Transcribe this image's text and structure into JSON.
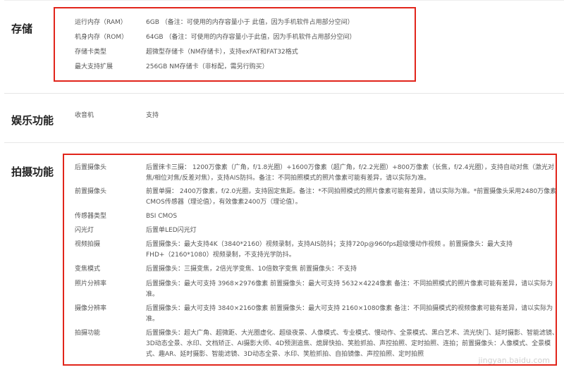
{
  "storage": {
    "title": "存储",
    "rows": [
      {
        "k": "运行内存（RAM）",
        "v": "6GB （备注：可使用的内存容量小于 此值，因为手机软件占用部分空间）"
      },
      {
        "k": "机身内存（ROM）",
        "v": "64GB （备注：可使用的内存容量小于此值，因为手机软件占用部分空间）"
      },
      {
        "k": "存储卡类型",
        "v": "超微型存储卡（NM存储卡），支持exFAT和FAT32格式"
      },
      {
        "k": "最大支持扩展",
        "v": "256GB NM存储卡（非标配，需另行购买）"
      }
    ]
  },
  "entertainment": {
    "title": "娱乐功能",
    "rows": [
      {
        "k": "收音机",
        "v": "支持"
      }
    ]
  },
  "camera": {
    "title": "拍摄功能",
    "rows": [
      {
        "k": "后置摄像头",
        "v": "后置徕卡三摄： 1200万像素（广角，f/1.8光圈）+1600万像素（超广角，f/2.2光圈）+800万像素（长焦，f/2.4光圈），支持自动对焦（激光对焦/相位对焦/反差对焦），支持AIS防抖。备注：不同拍照模式的照片像素可能有差异，请以实际为准。"
      },
      {
        "k": "前置摄像头",
        "v": "前置单摄： 2400万像素，f/2.0光圈，支持固定焦距。备注：*不同拍照模式的照片像素可能有差异，请以实际为准。*前置摄像头采用2480万像素CMOS传感器（理论值），有效像素2400万（理论值）。"
      },
      {
        "k": "传感器类型",
        "v": "BSI CMOS"
      },
      {
        "k": "闪光灯",
        "v": "后置单LED闪光灯"
      },
      {
        "k": "视频拍摄",
        "v": "后置摄像头：最大支持4K（3840*2160）视频录制，支持AIS防抖；支持720p@960fps超级慢动作视频 。前置摄像头：最大支持FHD+（2160*1080）视频录制，不支持光学防抖。"
      },
      {
        "k": "变焦模式",
        "v": "后置摄像头：三摄变焦，2倍光学变焦、10倍数字变焦 前置摄像头：不支持"
      },
      {
        "k": "照片分辨率",
        "v": "后置摄像头：最大可支持 3968×2976像素 前置摄像头：最大可支持 5632×4224像素 备注：不同拍照模式的照片像素可能有差异，请以实际为准。"
      },
      {
        "k": "摄像分辨率",
        "v": "后置摄像头：最大可支持 3840×2160像素 前置摄像头：最大可支持 2160×1080像素 备注：不同拍摄模式的视频像素可能有差异，请以实际为准。"
      },
      {
        "k": "拍摄功能",
        "v": "后置摄像头：超大广角、超微距、大光圈虚化、超级夜景、人像模式、专业模式、慢动作、全景模式、黑白艺术、流光快门、延时摄影、智能滤镜、3D动态全景、水印、文档矫正、AI摄影大师、4D预测追焦、熄屏快拍、笑脸抓拍、声控拍照、定时拍照、连拍；前置摄像头：人像模式、全景模式、趣AR、延时摄影、智能滤镜、3D动态全景、水印、笑脸抓拍、自拍镜像、声控拍照、定时拍照"
      }
    ]
  },
  "watermark": "jingyan.baidu.com"
}
